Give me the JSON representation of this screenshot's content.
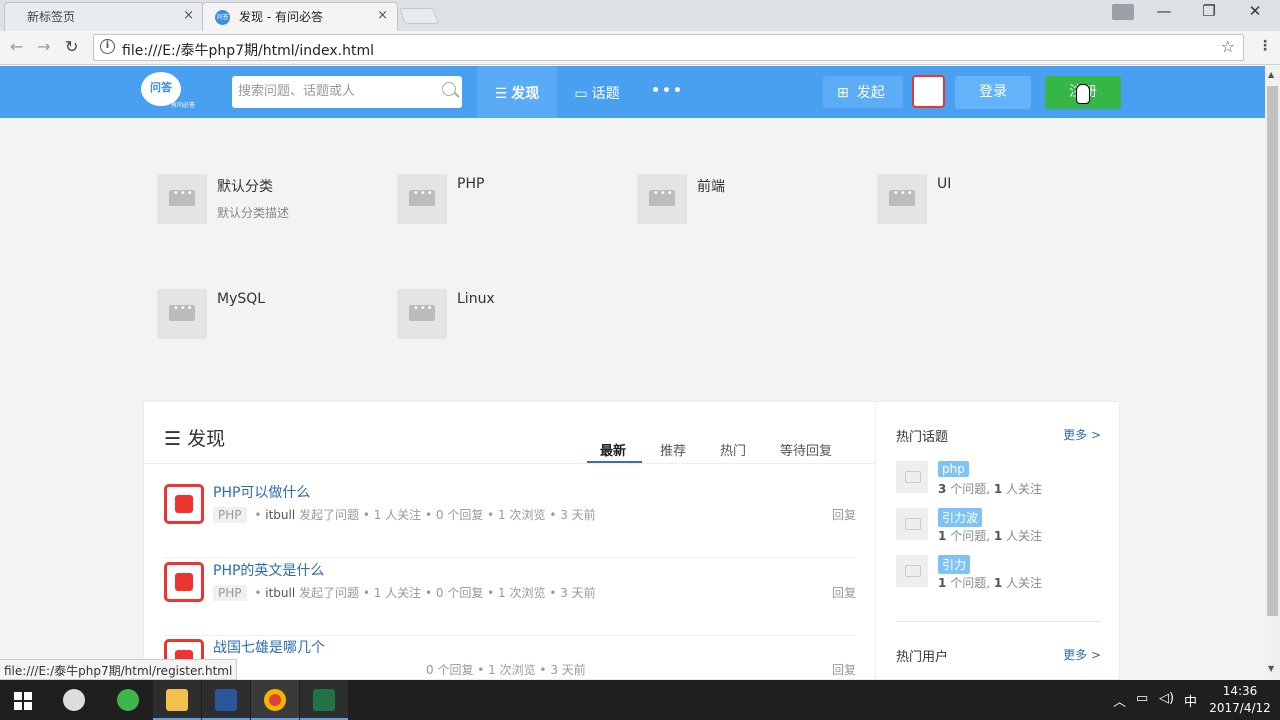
{
  "browser": {
    "tabs": [
      {
        "label": "新标签页",
        "close": "×"
      },
      {
        "label": "发现 - 有问必答",
        "close": "×"
      }
    ],
    "favicon_text": "问答",
    "url": "file:///E:/泰牛php7期/html/index.html",
    "status_url": "file:///E:/泰牛php7期/html/register.html",
    "window_controls": {
      "minimize": "—",
      "restore": "❐",
      "close": "✕"
    },
    "nav": {
      "back": "←",
      "forward": "→",
      "reload": "↻"
    }
  },
  "site": {
    "logo_text": "问答",
    "logo_sub": "有问必答",
    "search_placeholder": "搜索问题、话题或人",
    "nav": [
      {
        "icon": "☰",
        "label": "发现",
        "active": true
      },
      {
        "icon": "▭",
        "label": "话题",
        "active": false
      },
      {
        "icon": "",
        "label": "•••",
        "active": false
      }
    ],
    "publish_label": "发起",
    "login_label": "登录",
    "register_label": "注册",
    "colors": {
      "header": "#4aa0f0",
      "register": "#35b647",
      "link": "#2b6cb3"
    }
  },
  "categories": [
    {
      "name": "默认分类",
      "desc": "默认分类描述"
    },
    {
      "name": "PHP",
      "desc": ""
    },
    {
      "name": "前端",
      "desc": ""
    },
    {
      "name": "UI",
      "desc": ""
    },
    {
      "name": "MySQL",
      "desc": ""
    },
    {
      "name": "Linux",
      "desc": ""
    }
  ],
  "main": {
    "title": "发现",
    "tabs": [
      "最新",
      "推荐",
      "热门",
      "等待回复"
    ],
    "questions": [
      {
        "title": "PHP可以做什么",
        "tag": "PHP",
        "user": "itbull",
        "action": "发起了问题",
        "stats": "• 1 人关注 • 0 个回复 • 1 次浏览 • 3 天前",
        "reply": "回复"
      },
      {
        "title": "PHP的英文是什么",
        "tag": "PHP",
        "user": "itbull",
        "action": "发起了问题",
        "stats": "• 1 人关注 • 0 个回复 • 1 次浏览 • 3 天前",
        "reply": "回复"
      },
      {
        "title": "战国七雄是哪几个",
        "tag": "",
        "user": "",
        "action": "",
        "stats": "0 个回复 • 1 次浏览 • 3 天前",
        "reply": "回复"
      }
    ]
  },
  "sidebar": {
    "hot_topics_title": "热门话题",
    "more": "更多 >",
    "topics": [
      {
        "name": "php",
        "q": "3",
        "q_label": "个问题,",
        "f": "1",
        "f_label": "人关注"
      },
      {
        "name": "引力波",
        "q": "1",
        "q_label": "个问题,",
        "f": "1",
        "f_label": "人关注"
      },
      {
        "name": "引力",
        "q": "1",
        "q_label": "个问题,",
        "f": "1",
        "f_label": "人关注"
      }
    ],
    "hot_users_title": "热门用户",
    "more2": "更多 >"
  },
  "taskbar": {
    "apps": [
      "start",
      "app-flower-icon",
      "app-green-icon",
      "file-explorer-icon",
      "word-icon",
      "chrome-icon",
      "excel-icon"
    ],
    "ime": "中",
    "time": "14:36",
    "date": "2017/4/12"
  }
}
